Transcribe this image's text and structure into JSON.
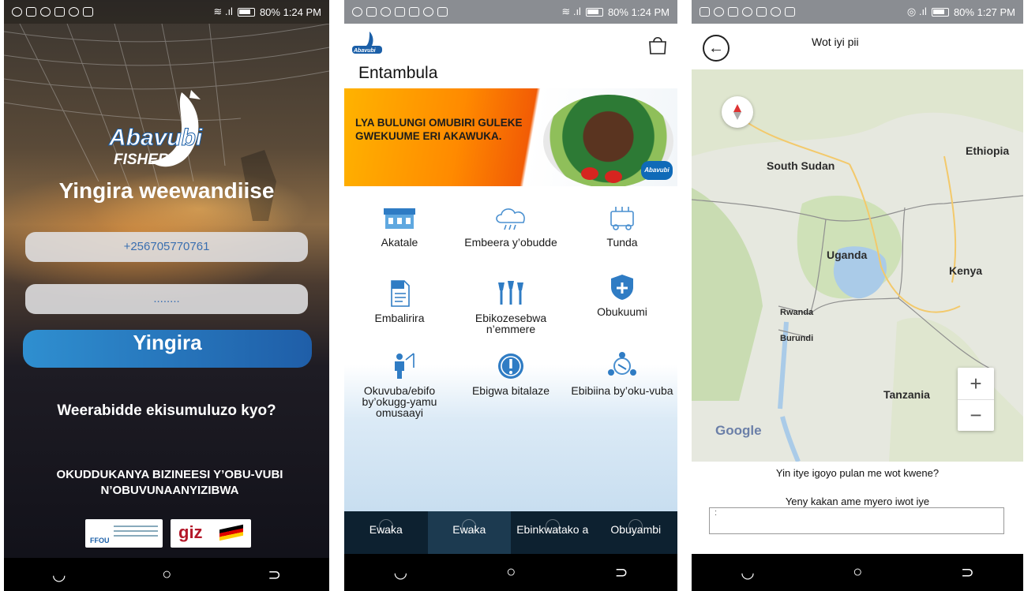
{
  "status": {
    "s1_right": "80% 1:24 PM",
    "s2_right": "80% 1:24 PM",
    "s3_right": "80% 1:27 PM"
  },
  "login": {
    "logo_text": "Abavubi",
    "logo_sub": "FISHER",
    "title": "Yingira weewandiise",
    "phone_value": "+256705770761",
    "password_value": "........",
    "login_button": "Yingira",
    "forgot_link": "Weerabidde ekisumuluzo kyo?",
    "slogan": "OKUDDUKANYA BIZINEESI Y’OBU-VUBI N’OBUVUNAANYIZIBWA",
    "partner_1": "FFOU",
    "partner_2": "giz"
  },
  "home": {
    "logo_text": "Abavubi",
    "title": "Entambula",
    "banner_text": "LYA BULUNGI OMUBIRI GULEKE GWEKUUME ERI AKAWUKA.",
    "banner_logo": "Abavubi",
    "menu": [
      {
        "label": "Akatale"
      },
      {
        "label": "Embeera y’obudde"
      },
      {
        "label": "Tunda"
      },
      {
        "label": "Embalirira"
      },
      {
        "label": "Ebikozesebwa n’emmere"
      },
      {
        "label": "Obukuumi"
      },
      {
        "label": "Okuvuba/ebifo by’okugg-yamu omusaayi"
      },
      {
        "label": "Ebigwa bitalaze"
      },
      {
        "label": "Ebibiina by’oku-vuba"
      }
    ],
    "bottom_nav": [
      {
        "label": "Ewaka"
      },
      {
        "label": "Ewaka"
      },
      {
        "label": "Ebinkwatako a"
      },
      {
        "label": "Obuyambi"
      }
    ]
  },
  "map_screen": {
    "title": "Wot iyi pii",
    "map_labels": {
      "south_sudan": "South Sudan",
      "ethiopia": "Ethiopia",
      "uganda": "Uganda",
      "kenya": "Kenya",
      "rwanda": "Rwanda",
      "burundi": "Burundi",
      "tanzania": "Tanzania"
    },
    "zoom_in": "+",
    "zoom_out": "−",
    "google": "Google",
    "question_1": "Yin itye igoyo pulan me wot kwene?",
    "question_2": "Yeny kakan ame myero iwot iye",
    "input_value": ":"
  },
  "colors": {
    "login_button": "#2a7cc4",
    "bottom_nav": "#0d2130",
    "banner_orange": "#f57c00"
  }
}
